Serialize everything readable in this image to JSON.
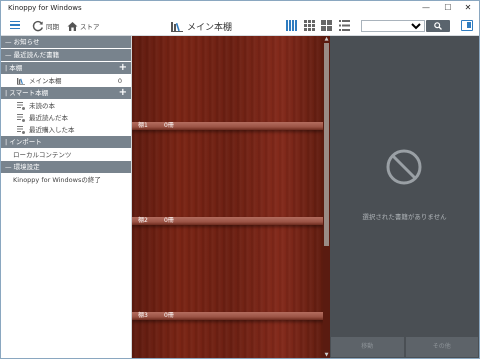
{
  "window": {
    "title": "Kinoppy for Windows",
    "controls": {
      "minimize": "—",
      "maximize": "☐",
      "close": "✕"
    }
  },
  "toolbar": {
    "sync_label": "同期",
    "store_label": "ストア",
    "current_shelf": "メイン本棚",
    "search_select": "",
    "view_modes": [
      "shelf-view",
      "grid-large",
      "grid-small",
      "list"
    ],
    "active_view": "shelf-view",
    "accent": "#2f7cc0"
  },
  "sidebar": {
    "sections": {
      "news": "お知らせ",
      "recent": "最近読んだ書籍",
      "bookshelf": "本棚",
      "smart": "スマート本棚",
      "import": "インポート",
      "settings": "環境設定"
    },
    "bookshelf_items": [
      {
        "label": "メイン本棚",
        "count": "0"
      }
    ],
    "smart_items": [
      {
        "label": "未読の本"
      },
      {
        "label": "最近読んだ本"
      },
      {
        "label": "最近購入した本"
      }
    ],
    "import_items": [
      {
        "label": "ローカルコンテンツ"
      }
    ],
    "settings_items": [
      {
        "label": "Kinoppy for Windowsの終了"
      }
    ]
  },
  "shelf": {
    "rows": [
      {
        "name": "棚1",
        "count": "0冊"
      },
      {
        "name": "棚2",
        "count": "0冊"
      },
      {
        "name": "棚3",
        "count": "0冊"
      }
    ]
  },
  "detail": {
    "empty_message": "選択された書籍がありません",
    "move_button": "移動",
    "other_button": "その他"
  }
}
